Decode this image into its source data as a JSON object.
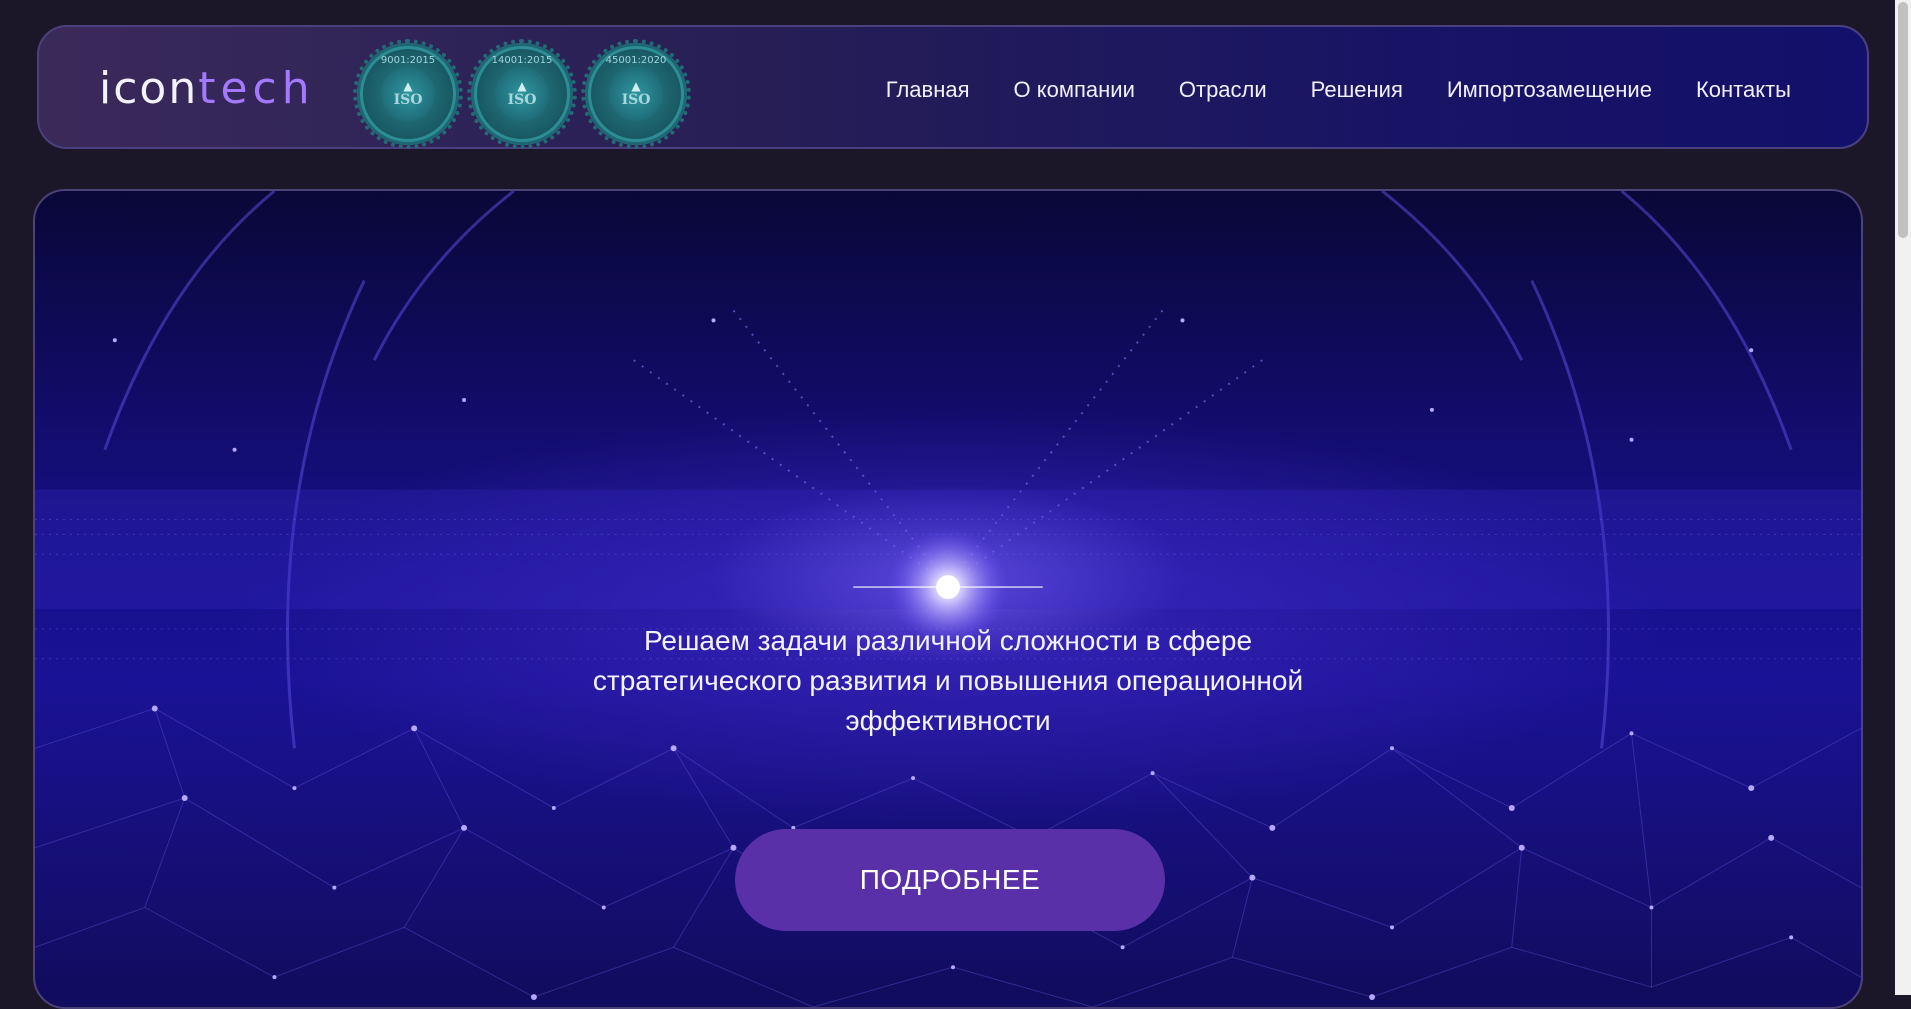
{
  "header": {
    "logo": {
      "part_a": "icon",
      "part_b": "tech"
    },
    "badges": [
      {
        "code": "9001:2015",
        "label": "ISO",
        "icon": "iso-certificate-icon"
      },
      {
        "code": "14001:2015",
        "label": "ISO",
        "icon": "iso-certificate-icon"
      },
      {
        "code": "45001:2020",
        "label": "ISO",
        "icon": "iso-certificate-icon"
      }
    ],
    "nav": [
      "Главная",
      "О компании",
      "Отрасли",
      "Решения",
      "Импортозамещение",
      "Контакты"
    ]
  },
  "hero": {
    "tagline": "Решаем задачи различной сложности в сфере стратегического развития и повышения операционной эффективности",
    "cta_label": "ПОДРОБНЕЕ"
  },
  "colors": {
    "page_bg": "#1b1728",
    "accent": "#a37aff",
    "cta_bg": "#5a30a8"
  }
}
